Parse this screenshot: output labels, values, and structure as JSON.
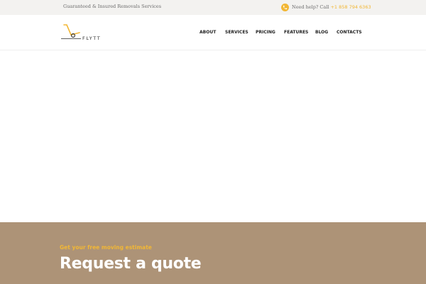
{
  "topbar": {
    "tagline": "Guaranteed & Insured Removals Services",
    "help_label": "Need help? Call",
    "phone": "+1 858 794 6363",
    "phone_icon": "phone-icon"
  },
  "header": {
    "logo_text": "FLYTT",
    "nav": [
      {
        "label": "ABOUT"
      },
      {
        "label": "SERVICES"
      },
      {
        "label": "PRICING"
      },
      {
        "label": "FEATURES"
      },
      {
        "label": "BLOG"
      },
      {
        "label": "CONTACTS"
      }
    ]
  },
  "quote": {
    "kicker": "Get your free moving estimate",
    "title": "Request a quote"
  },
  "colors": {
    "accent": "#f2b735",
    "quote_bg": "#ad9377",
    "topbar_bg": "#f3f2f0"
  }
}
